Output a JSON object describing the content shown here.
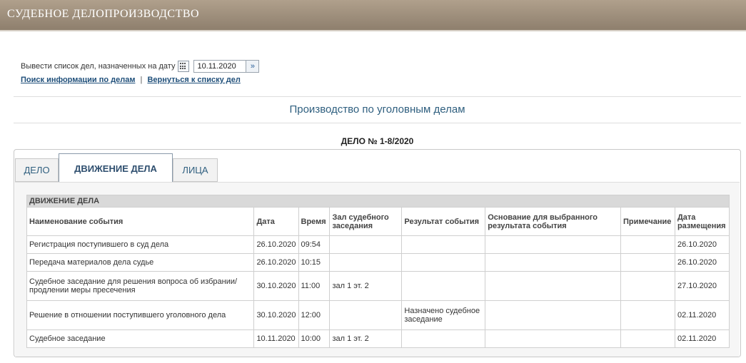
{
  "header": {
    "title": "СУДЕБНОЕ ДЕЛОПРОИЗВОДСТВО"
  },
  "datebar": {
    "label": "Вывести список дел, назначенных на дату",
    "date_value": "10.11.2020",
    "go_symbol": "»"
  },
  "links": {
    "search": "Поиск информации по делам",
    "separator": "|",
    "back": "Вернуться к списку дел"
  },
  "section_title": "Производство по уголовным делам",
  "case_number": "ДЕЛО № 1-8/2020",
  "tabs": [
    {
      "label": "ДЕЛО"
    },
    {
      "label": "ДВИЖЕНИЕ ДЕЛА"
    },
    {
      "label": "ЛИЦА"
    }
  ],
  "table": {
    "caption": "ДВИЖЕНИЕ ДЕЛА",
    "headers": {
      "event": "Наименование события",
      "date": "Дата",
      "time": "Время",
      "hall": "Зал судебного заседания",
      "result": "Результат события",
      "basis": "Основание для выбранного результата события",
      "note": "Примечание",
      "posted": "Дата размещения"
    },
    "rows": [
      {
        "event": "Регистрация поступившего в суд дела",
        "date": "26.10.2020",
        "time": "09:54",
        "hall": "",
        "result": "",
        "basis": "",
        "note": "",
        "posted": "26.10.2020"
      },
      {
        "event": "Передача материалов дела судье",
        "date": "26.10.2020",
        "time": "10:15",
        "hall": "",
        "result": "",
        "basis": "",
        "note": "",
        "posted": "26.10.2020"
      },
      {
        "event": "Судебное заседание для решения вопроса об избрании/ продлении меры пресечения",
        "date": "30.10.2020",
        "time": "11:00",
        "hall": "зал 1 эт. 2",
        "result": "",
        "basis": "",
        "note": "",
        "posted": "27.10.2020"
      },
      {
        "event": "Решение в отношении поступившего уголовного дела",
        "date": "30.10.2020",
        "time": "12:00",
        "hall": "",
        "result": "Назначено судебное заседание",
        "basis": "",
        "note": "",
        "posted": "02.11.2020"
      },
      {
        "event": "Судебное заседание",
        "date": "10.11.2020",
        "time": "10:00",
        "hall": "зал 1 эт. 2",
        "result": "",
        "basis": "",
        "note": "",
        "posted": "02.11.2020"
      }
    ]
  }
}
